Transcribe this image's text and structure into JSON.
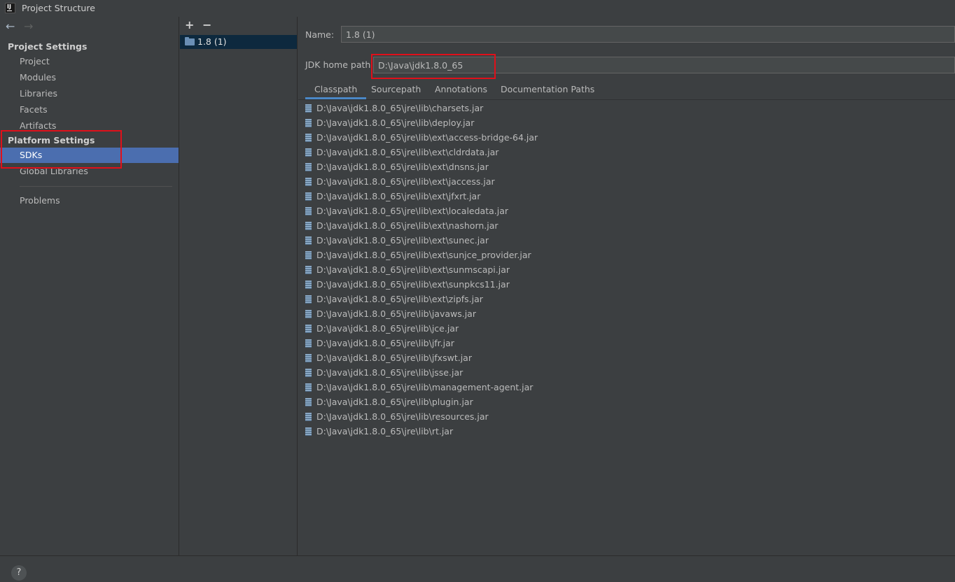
{
  "window": {
    "title": "Project Structure",
    "logo_text": "IJ"
  },
  "nav": {
    "back_icon": "←",
    "forward_icon": "→"
  },
  "sidebar": {
    "project_settings_header": "Project Settings",
    "project_items": [
      {
        "label": "Project"
      },
      {
        "label": "Modules"
      },
      {
        "label": "Libraries"
      },
      {
        "label": "Facets"
      },
      {
        "label": "Artifacts"
      }
    ],
    "platform_settings_header": "Platform Settings",
    "platform_items": [
      {
        "label": "SDKs",
        "selected": true
      },
      {
        "label": "Global Libraries"
      }
    ],
    "problems_label": "Problems"
  },
  "sdk_list": {
    "add_icon": "+",
    "remove_icon": "−",
    "items": [
      {
        "label": "1.8 (1)",
        "selected": true
      }
    ]
  },
  "main": {
    "name_label": "Name:",
    "name_value": "1.8 (1)",
    "jdk_home_label": "JDK home path:",
    "jdk_home_value": "D:\\Java\\jdk1.8.0_65",
    "tabs": [
      {
        "label": "Classpath",
        "active": true
      },
      {
        "label": "Sourcepath"
      },
      {
        "label": "Annotations"
      },
      {
        "label": "Documentation Paths"
      }
    ],
    "classpath": [
      "D:\\Java\\jdk1.8.0_65\\jre\\lib\\charsets.jar",
      "D:\\Java\\jdk1.8.0_65\\jre\\lib\\deploy.jar",
      "D:\\Java\\jdk1.8.0_65\\jre\\lib\\ext\\access-bridge-64.jar",
      "D:\\Java\\jdk1.8.0_65\\jre\\lib\\ext\\cldrdata.jar",
      "D:\\Java\\jdk1.8.0_65\\jre\\lib\\ext\\dnsns.jar",
      "D:\\Java\\jdk1.8.0_65\\jre\\lib\\ext\\jaccess.jar",
      "D:\\Java\\jdk1.8.0_65\\jre\\lib\\ext\\jfxrt.jar",
      "D:\\Java\\jdk1.8.0_65\\jre\\lib\\ext\\localedata.jar",
      "D:\\Java\\jdk1.8.0_65\\jre\\lib\\ext\\nashorn.jar",
      "D:\\Java\\jdk1.8.0_65\\jre\\lib\\ext\\sunec.jar",
      "D:\\Java\\jdk1.8.0_65\\jre\\lib\\ext\\sunjce_provider.jar",
      "D:\\Java\\jdk1.8.0_65\\jre\\lib\\ext\\sunmscapi.jar",
      "D:\\Java\\jdk1.8.0_65\\jre\\lib\\ext\\sunpkcs11.jar",
      "D:\\Java\\jdk1.8.0_65\\jre\\lib\\ext\\zipfs.jar",
      "D:\\Java\\jdk1.8.0_65\\jre\\lib\\javaws.jar",
      "D:\\Java\\jdk1.8.0_65\\jre\\lib\\jce.jar",
      "D:\\Java\\jdk1.8.0_65\\jre\\lib\\jfr.jar",
      "D:\\Java\\jdk1.8.0_65\\jre\\lib\\jfxswt.jar",
      "D:\\Java\\jdk1.8.0_65\\jre\\lib\\jsse.jar",
      "D:\\Java\\jdk1.8.0_65\\jre\\lib\\management-agent.jar",
      "D:\\Java\\jdk1.8.0_65\\jre\\lib\\plugin.jar",
      "D:\\Java\\jdk1.8.0_65\\jre\\lib\\resources.jar",
      "D:\\Java\\jdk1.8.0_65\\jre\\lib\\rt.jar"
    ]
  },
  "footer": {
    "help_icon": "?"
  },
  "colors": {
    "background": "#3c3f41",
    "selection": "#4b6eaf",
    "sdk_selection": "#0d293e",
    "highlight_box": "#e0101a",
    "active_tab_underline": "#4a88c7"
  }
}
